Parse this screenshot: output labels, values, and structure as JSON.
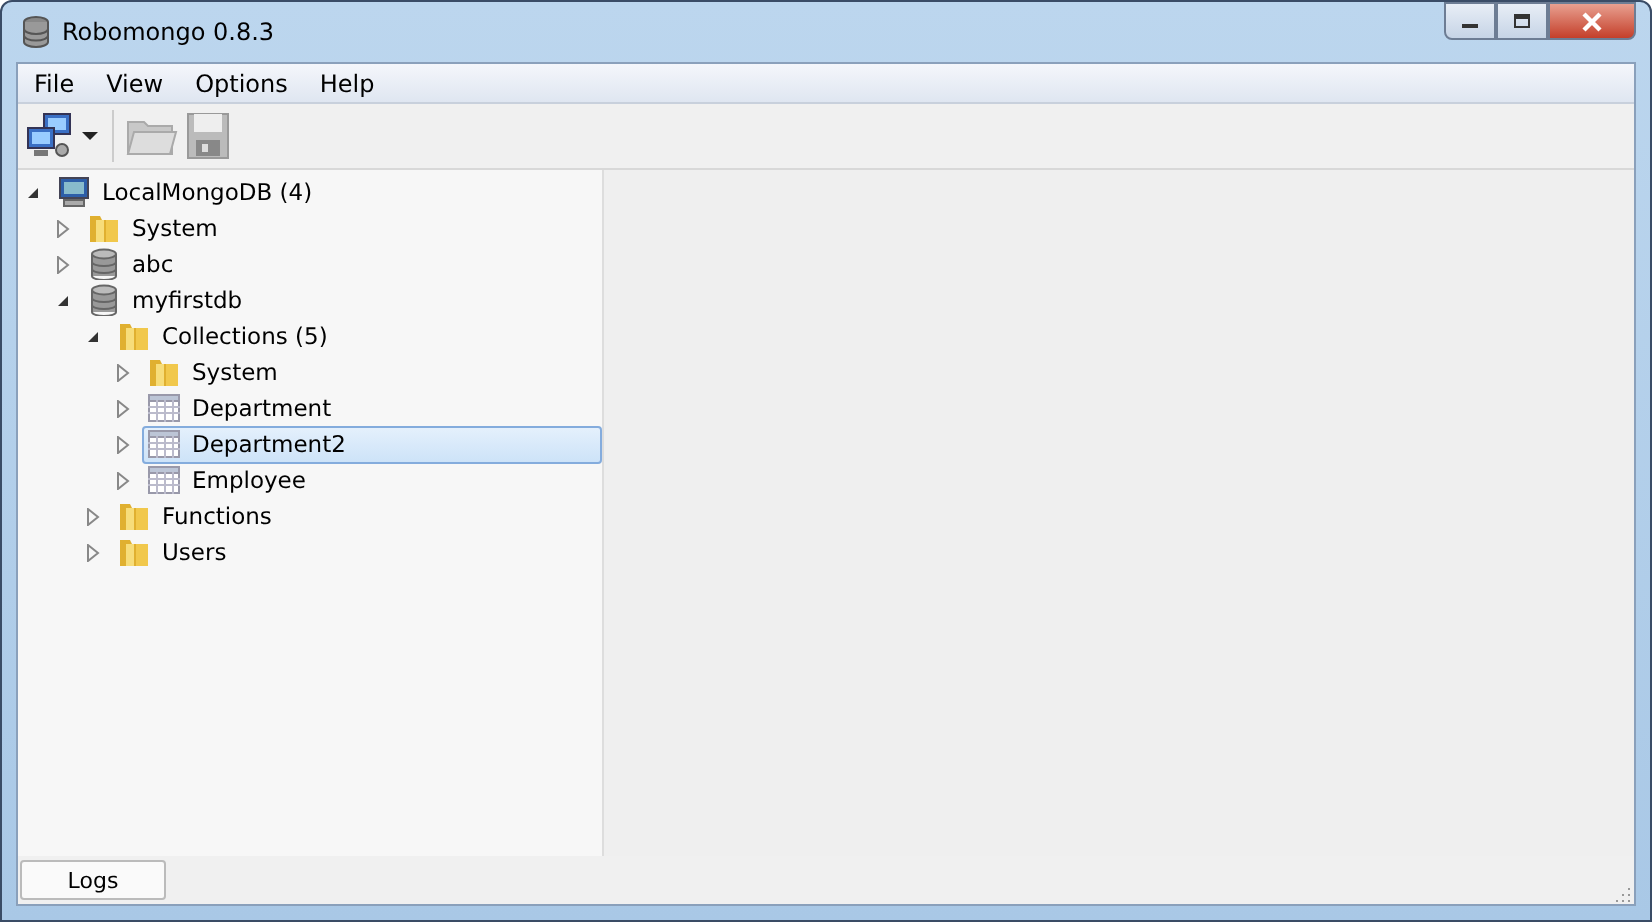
{
  "window": {
    "title": "Robomongo 0.8.3"
  },
  "menu": [
    "File",
    "View",
    "Options",
    "Help"
  ],
  "tree": [
    {
      "label": "LocalMongoDB (4)",
      "kind": "server",
      "expanded": true,
      "selected": false,
      "children": [
        {
          "label": "System",
          "kind": "folder",
          "expanded": false,
          "selected": false
        },
        {
          "label": "abc",
          "kind": "database",
          "expanded": false,
          "selected": false
        },
        {
          "label": "myfirstdb",
          "kind": "database",
          "expanded": true,
          "selected": false,
          "children": [
            {
              "label": "Collections (5)",
              "kind": "folder",
              "expanded": true,
              "selected": false,
              "children": [
                {
                  "label": "System",
                  "kind": "folder",
                  "expanded": false,
                  "selected": false
                },
                {
                  "label": "Department",
                  "kind": "collection",
                  "expanded": false,
                  "selected": false
                },
                {
                  "label": "Department2",
                  "kind": "collection",
                  "expanded": false,
                  "selected": true
                },
                {
                  "label": "Employee",
                  "kind": "collection",
                  "expanded": false,
                  "selected": false
                }
              ]
            },
            {
              "label": "Functions",
              "kind": "folder",
              "expanded": false,
              "selected": false
            },
            {
              "label": "Users",
              "kind": "folder",
              "expanded": false,
              "selected": false
            }
          ]
        }
      ]
    }
  ],
  "bottom_tabs": [
    {
      "label": "Logs",
      "selected": true
    }
  ]
}
